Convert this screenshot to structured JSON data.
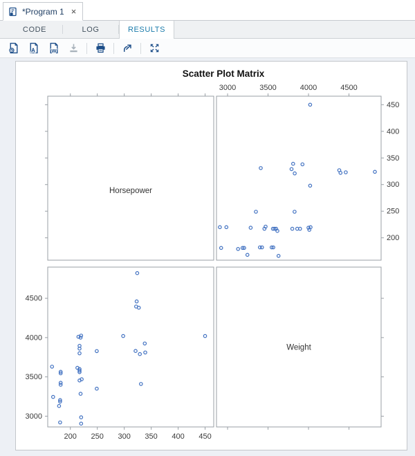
{
  "window": {
    "tab_title": "*Program 1",
    "close_glyph": "×"
  },
  "view_tabs": [
    {
      "label": "CODE",
      "active": false
    },
    {
      "label": "LOG",
      "active": false
    },
    {
      "label": "RESULTS",
      "active": true
    }
  ],
  "toolbar": {
    "icons": [
      "refresh-html-results",
      "download-pdf",
      "download-word",
      "download-results",
      "print-results",
      "open-in-new-window",
      "maximize-view"
    ]
  },
  "colors": {
    "marker": "#4171c1",
    "panel_border": "#999fa5",
    "axis_text": "#3a3a3a",
    "active_tab_text": "#1a7bab",
    "icon_navy": "#1d4e89",
    "icon_disabled": "#a8b2bb",
    "content_bg": "#edf0f5"
  },
  "chart_data": {
    "type": "scatter",
    "subtype": "scatter-plot-matrix",
    "title": "Scatter Plot Matrix",
    "matrix_variables": [
      "Horsepower",
      "Weight"
    ],
    "diagonal_labels": [
      "Horsepower",
      "Weight"
    ],
    "grid": false,
    "legend": null,
    "axes": {
      "weight": {
        "ticks": [
          3000,
          3500,
          4000,
          4500
        ],
        "range": [
          2863,
          4897
        ]
      },
      "horsepower": {
        "ticks": [
          200,
          250,
          300,
          350,
          400,
          450
        ],
        "range": [
          158,
          466
        ]
      }
    },
    "points": [
      {
        "weight": 4020,
        "horsepower": 450
      },
      {
        "weight": 3410,
        "horsepower": 331
      },
      {
        "weight": 3790,
        "horsepower": 329
      },
      {
        "weight": 3810,
        "horsepower": 339
      },
      {
        "weight": 3830,
        "horsepower": 321
      },
      {
        "weight": 3925,
        "horsepower": 338
      },
      {
        "weight": 4380,
        "horsepower": 327
      },
      {
        "weight": 4395,
        "horsepower": 322
      },
      {
        "weight": 4460,
        "horsepower": 323
      },
      {
        "weight": 4820,
        "horsepower": 324
      },
      {
        "weight": 4020,
        "horsepower": 298
      },
      {
        "weight": 3350,
        "horsepower": 249
      },
      {
        "weight": 3828,
        "horsepower": 249
      },
      {
        "weight": 2905,
        "horsepower": 220
      },
      {
        "weight": 2985,
        "horsepower": 220
      },
      {
        "weight": 3285,
        "horsepower": 219
      },
      {
        "weight": 3455,
        "horsepower": 217
      },
      {
        "weight": 3470,
        "horsepower": 221
      },
      {
        "weight": 3560,
        "horsepower": 217
      },
      {
        "weight": 3580,
        "horsepower": 217
      },
      {
        "weight": 3600,
        "horsepower": 217
      },
      {
        "weight": 3615,
        "horsepower": 213
      },
      {
        "weight": 3800,
        "horsepower": 217
      },
      {
        "weight": 3860,
        "horsepower": 217
      },
      {
        "weight": 3895,
        "horsepower": 217
      },
      {
        "weight": 4000,
        "horsepower": 219
      },
      {
        "weight": 4010,
        "horsepower": 215
      },
      {
        "weight": 4025,
        "horsepower": 220
      },
      {
        "weight": 2920,
        "horsepower": 181
      },
      {
        "weight": 3130,
        "horsepower": 179
      },
      {
        "weight": 3185,
        "horsepower": 181
      },
      {
        "weight": 3205,
        "horsepower": 181
      },
      {
        "weight": 3400,
        "horsepower": 182
      },
      {
        "weight": 3425,
        "horsepower": 182
      },
      {
        "weight": 3545,
        "horsepower": 182
      },
      {
        "weight": 3565,
        "horsepower": 182
      },
      {
        "weight": 3245,
        "horsepower": 168
      },
      {
        "weight": 3630,
        "horsepower": 166
      }
    ]
  }
}
